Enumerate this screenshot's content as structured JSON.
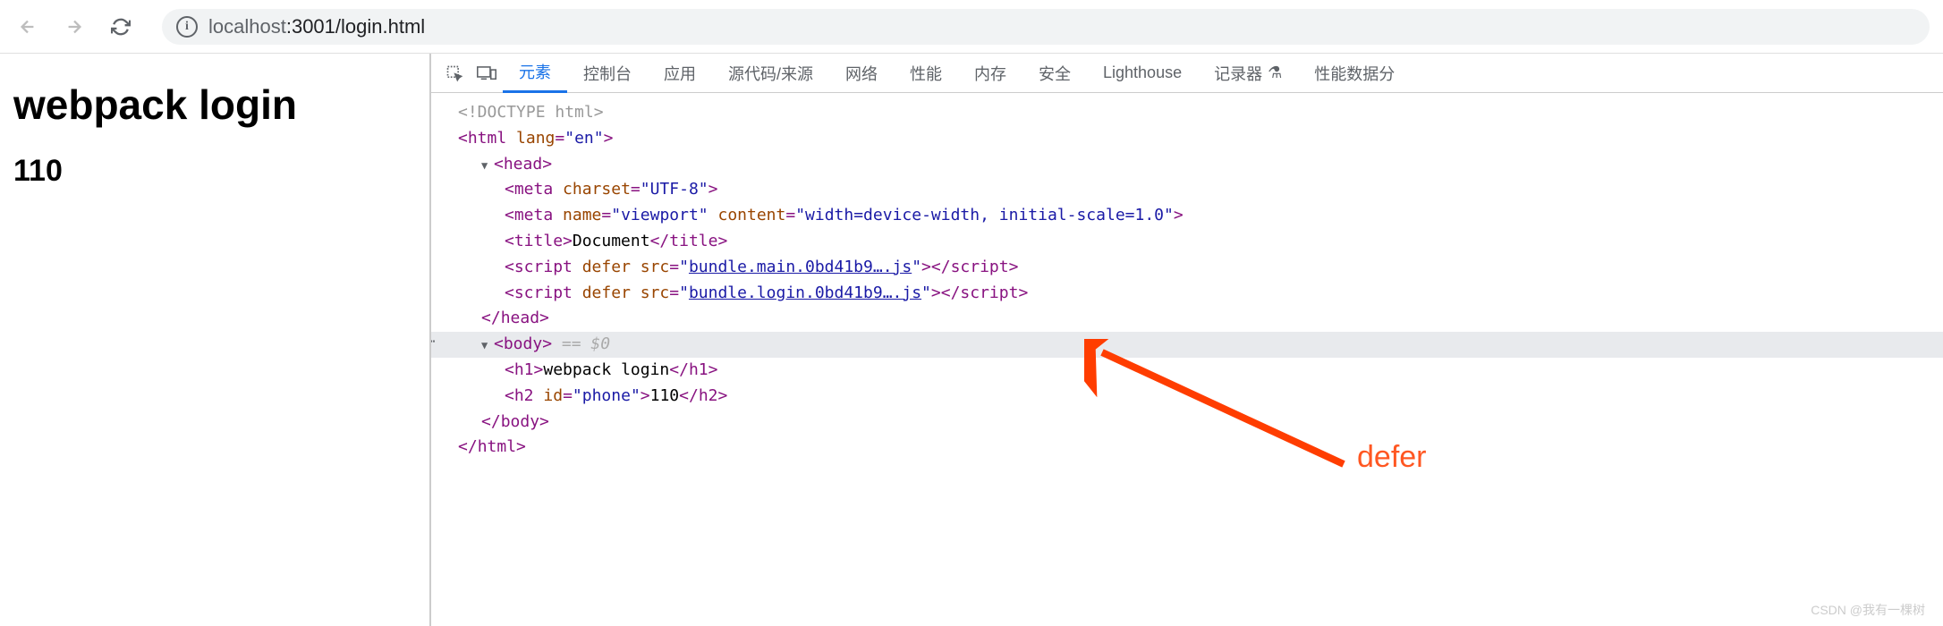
{
  "toolbar": {
    "url_host": "localhost",
    "url_path": ":3001/login.html"
  },
  "page": {
    "h1": "webpack login",
    "h2": "110"
  },
  "devtools": {
    "tabs": {
      "elements": "元素",
      "console": "控制台",
      "application": "应用",
      "sources": "源代码/来源",
      "network": "网络",
      "performance": "性能",
      "memory": "内存",
      "security": "安全",
      "lighthouse": "Lighthouse",
      "recorder": "记录器",
      "perf_insights": "性能数据分"
    },
    "recorder_icon": "⚗"
  },
  "code": {
    "doctype": "<!DOCTYPE html>",
    "html_open": {
      "tag": "html",
      "attr": "lang",
      "val": "en"
    },
    "head_open": "head",
    "meta1": {
      "tag": "meta",
      "attr": "charset",
      "val": "UTF-8"
    },
    "meta2": {
      "tag": "meta",
      "a1": "name",
      "v1": "viewport",
      "a2": "content",
      "v2": "width=device-width, initial-scale=1.0"
    },
    "title": {
      "tag": "title",
      "text": "Document"
    },
    "script1": {
      "tag": "script",
      "a1": "defer",
      "a2": "src",
      "link": "bundle.main.0bd41b9….js"
    },
    "script2": {
      "tag": "script",
      "a1": "defer",
      "a2": "src",
      "link": "bundle.login.0bd41b9….js"
    },
    "head_close": "head",
    "body_open": "body",
    "body_suffix": " == $0",
    "h1": {
      "tag": "h1",
      "text": "webpack login"
    },
    "h2": {
      "tag": "h2",
      "attr": "id",
      "val": "phone",
      "text": "110"
    },
    "body_close": "body",
    "html_close": "html"
  },
  "annotation": {
    "label": "defer"
  },
  "watermark": "CSDN @我有一棵树"
}
